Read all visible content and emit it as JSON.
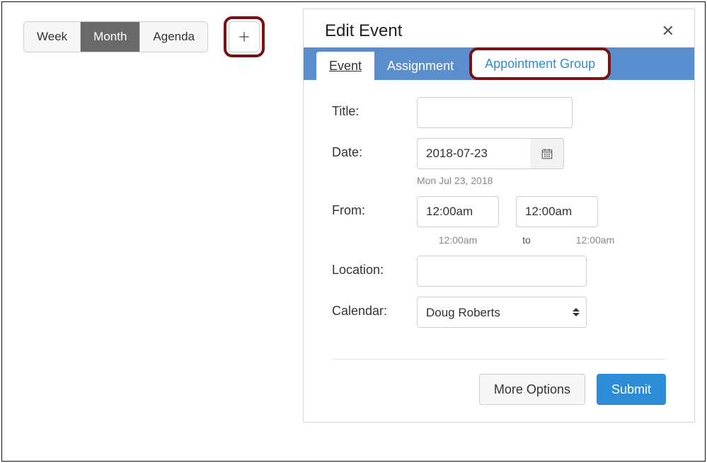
{
  "toolbar": {
    "views": [
      "Week",
      "Month",
      "Agenda"
    ],
    "active_view_index": 1
  },
  "dialog": {
    "title": "Edit Event",
    "tabs": {
      "event": "Event",
      "assignment": "Assignment",
      "appointment_group": "Appointment Group",
      "active": "event"
    },
    "form": {
      "title_label": "Title:",
      "title_value": "",
      "date_label": "Date:",
      "date_value": "2018-07-23",
      "date_readable": "Mon Jul 23, 2018",
      "from_label": "From:",
      "time_start": "12:00am",
      "time_end": "12:00am",
      "time_start_readable": "12:00am",
      "time_sep": "to",
      "time_end_readable": "12:00am",
      "location_label": "Location:",
      "location_value": "",
      "calendar_label": "Calendar:",
      "calendar_selected": "Doug Roberts"
    },
    "buttons": {
      "more_options": "More Options",
      "submit": "Submit"
    }
  }
}
